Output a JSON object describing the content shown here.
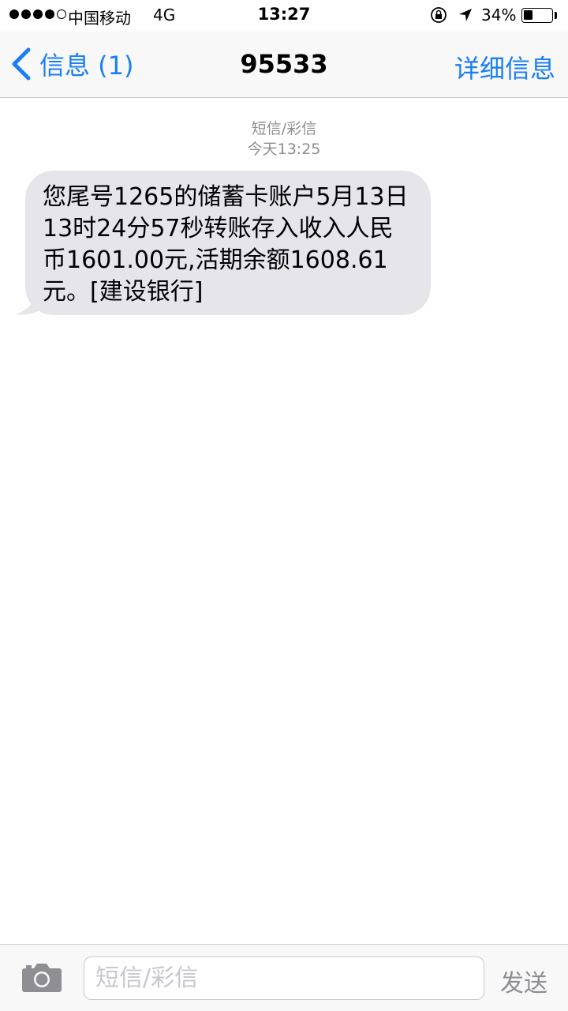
{
  "status_bar": {
    "carrier": "中国移动",
    "network": "4G",
    "time": "13:27",
    "battery_percent": "34%",
    "battery_level": 0.34
  },
  "nav": {
    "back_label": "信息 (1)",
    "title": "95533",
    "details_label": "详细信息"
  },
  "thread": {
    "message_type": "短信/彩信",
    "timestamp": "今天13:25",
    "messages": [
      {
        "direction": "incoming",
        "text": "您尾号1265的储蓄卡账户5月13日13时24分57秒转账存入收入人民币1601.00元,活期余额1608.61元。[建设银行]"
      }
    ]
  },
  "input": {
    "placeholder": "短信/彩信",
    "value": "",
    "send_label": "发送"
  },
  "colors": {
    "accent": "#1a7ef5",
    "incoming_bubble": "#e5e5ea",
    "meta_text": "#8e8e93"
  },
  "icons": [
    "lock-rotation-icon",
    "location-arrow-icon",
    "chevron-left-icon",
    "camera-icon"
  ]
}
